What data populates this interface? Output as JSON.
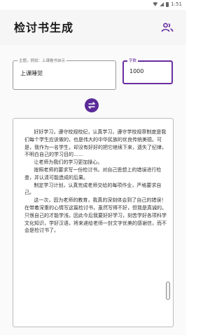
{
  "status_bar": {
    "time": "1:51"
  },
  "app": {
    "title": "检讨书生成"
  },
  "form": {
    "topic": {
      "label": "主题，例如：上课看书自示",
      "value": "上课睡觉"
    },
    "word_count": {
      "label": "字数",
      "value": "1000"
    }
  },
  "result": {
    "text": "      好好学习，遵守校规校纪，认真学习，遵守学校规章制度是我们每个学生应该做的，也是伟大的中华民族的优良传统美德。可是，我作为一名学生，却没有好好的把它继续下来，遗失了纪律，不明白自己的学习目的……\n      让老师为我们的学习更加操心。\n      按照老师的要求写一份检讨书。对自己思想上的错误进行检查，并认清可能造成的后果。\n      制定学习计划，认真完成老师交给的每项作业，严格要求自己。\n      这一次，因为老师的教育，我真的深刻体会到了自己的错误！在带着深重的心情写这篇检讨书，虽然写得不好，但我是真诚的。只恨自己的才能学浅，因此今后我要好好学习，刻苦学好各项科学文化知识，学好汉语，将来递给老师一封文字优美的感谢信，而不会是检讨书了。"
  },
  "colors": {
    "accent": "#5a2a98",
    "accent_border": "#6a2ea0",
    "appbar_bg": "#f6f6f6"
  },
  "icons": [
    "wifi-icon",
    "signal-icon",
    "battery-icon",
    "users-icon",
    "swap-icon"
  ]
}
